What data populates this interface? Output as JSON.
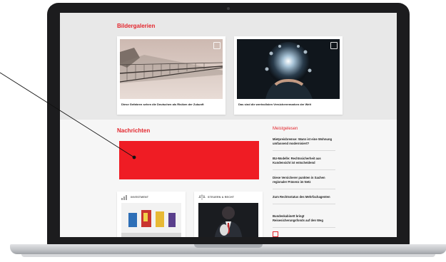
{
  "galleries": {
    "title": "Bildergalerien",
    "items": [
      {
        "caption": "Diese Gefahren sehen die Deutschen als Risiken der Zukunft",
        "icon": "gallery-icon"
      },
      {
        "caption": "Das sind die wertvollsten Versicherermarken der Welt",
        "icon": "gallery-icon"
      }
    ]
  },
  "news": {
    "title": "Nachrichten",
    "ad_color": "#ef1c24",
    "categories": [
      {
        "label": "INVESTMENT",
        "icon": "chart-icon"
      },
      {
        "label": "STEUERN & RECHT",
        "icon": "scales-icon"
      }
    ]
  },
  "most_read": {
    "title": "Meistgelesen",
    "items": [
      "Mietpreisbremse: Wann ist eine Wohnung umfassend modernisiert?",
      "BU-Modelle: Rechtssicherheit aus Kundensicht ist entscheidend",
      "Diese Versicherer punkten in Sachen regionaler Präsenz im Netz",
      "Zum Rechtsstatus des Mehrfachagenten",
      "Bundeskabinett bringt Reisesicherungsfonds auf den Weg"
    ]
  },
  "colors": {
    "accent": "#e3262d",
    "laptop_frame": "#1c1c1e"
  }
}
